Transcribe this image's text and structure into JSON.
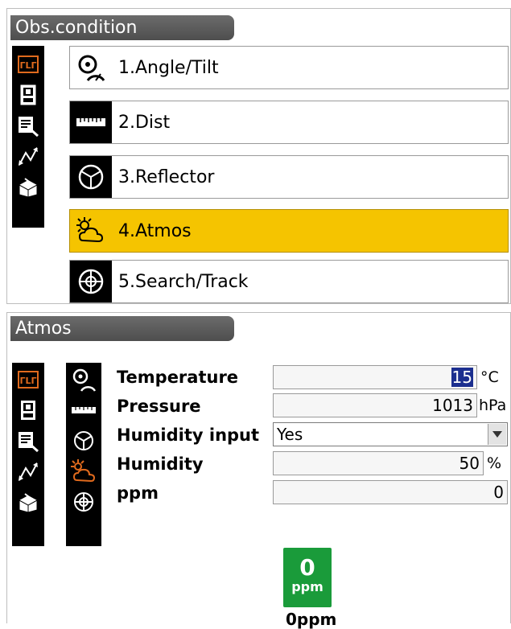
{
  "screen1": {
    "title": "Obs.condition",
    "sidebar_icons": [
      "tilt-symbol-icon",
      "instrument-icon",
      "edit-notes-icon",
      "measure-arrows-icon",
      "box-icon"
    ],
    "menu": [
      {
        "label": "1.Angle/Tilt",
        "icon": "angle-tilt-icon",
        "selected": false
      },
      {
        "label": "2.Dist",
        "icon": "ruler-icon",
        "selected": false
      },
      {
        "label": "3.Reflector",
        "icon": "reflector-icon",
        "selected": false
      },
      {
        "label": "4.Atmos",
        "icon": "sun-cloud-icon",
        "selected": true
      },
      {
        "label": "5.Search/Track",
        "icon": "crosshair-icon",
        "selected": false
      }
    ],
    "selected_color": "#f5c400"
  },
  "screen2": {
    "title": "Atmos",
    "fields": {
      "temperature": {
        "label": "Temperature",
        "value": "15",
        "unit": "°C"
      },
      "pressure": {
        "label": "Pressure",
        "value": "1013",
        "unit": "hPa"
      },
      "humidity_input": {
        "label": "Humidity input",
        "value": "Yes"
      },
      "humidity": {
        "label": "Humidity",
        "value": "50",
        "unit": "%"
      },
      "ppm": {
        "label": "ppm",
        "value": "0"
      }
    },
    "ppm_badge": {
      "value": "0",
      "unit": "ppm",
      "caption": "0ppm"
    },
    "accent_green": "#1a9b3a"
  }
}
